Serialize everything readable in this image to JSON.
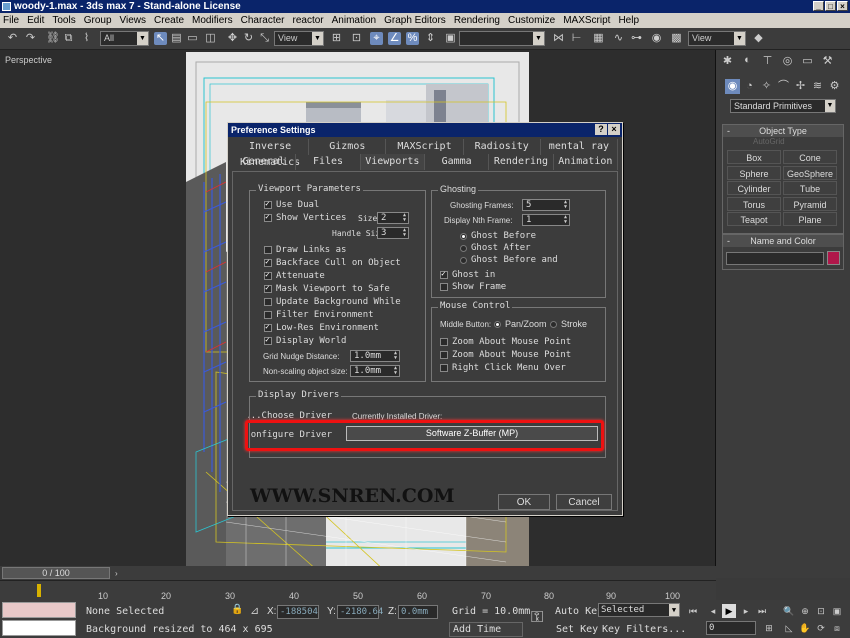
{
  "window": {
    "title": "woody-1.max - 3ds max 7 - Stand-alone License"
  },
  "menu": [
    "File",
    "Edit",
    "Tools",
    "Group",
    "Views",
    "Create",
    "Modifiers",
    "Character",
    "reactor",
    "Animation",
    "Graph Editors",
    "Rendering",
    "Customize",
    "MAXScript",
    "Help"
  ],
  "toolbar": {
    "selection_filter": "All",
    "ref_coord": "View",
    "named_sel": "",
    "view2": "View"
  },
  "viewport": {
    "label": "Perspective"
  },
  "cmdpanel": {
    "category": "Standard Primitives",
    "object_type_title": "Object Type",
    "autogrid": "AutoGrid",
    "objects": [
      "Box",
      "Cone",
      "Sphere",
      "GeoSphere",
      "Cylinder",
      "Tube",
      "Torus",
      "Pyramid",
      "Teapot",
      "Plane"
    ],
    "name_color_title": "Name and Color",
    "color": "#b0174a"
  },
  "dialog": {
    "title": "Preference Settings",
    "tabs_row1": [
      "Inverse Kinematics",
      "Gizmos",
      "MAXScript",
      "Radiosity",
      "mental ray"
    ],
    "tabs_row2": [
      "General",
      "Files",
      "Viewports",
      "Gamma",
      "Rendering",
      "Animation"
    ],
    "viewport_params": {
      "title": "Viewport Parameters",
      "use_dual": "Use Dual",
      "show_vertices": "Show Vertices",
      "size_label": "Size:",
      "size_value": "2",
      "handle_size_label": "Handle Size:",
      "handle_size_value": "3",
      "draw_links": "Draw Links as",
      "backface_cull": "Backface Cull on Object",
      "attenuate": "Attenuate",
      "mask_viewport": "Mask Viewport to Safe",
      "update_bg": "Update Background While",
      "filter_env": "Filter Environment",
      "lowres_env": "Low-Res Environment",
      "display_world": "Display World",
      "grid_nudge_label": "Grid Nudge Distance:",
      "grid_nudge_value": "1.0mm",
      "nonscaling_label": "Non-scaling object size:",
      "nonscaling_value": "1.0mm"
    },
    "ghosting": {
      "title": "Ghosting",
      "frames_label": "Ghosting Frames:",
      "frames_value": "5",
      "nth_label": "Display Nth Frame:",
      "nth_value": "1",
      "before": "Ghost Before",
      "after": "Ghost After",
      "before_and": "Ghost Before and",
      "ghost_in": "Ghost in",
      "show_frame": "Show Frame"
    },
    "mouse": {
      "title": "Mouse Control",
      "middle_label": "Middle Button:",
      "pan_zoom": "Pan/Zoom",
      "stroke": "Stroke",
      "zoom_mouse1": "Zoom About Mouse Point",
      "zoom_mouse2": "Zoom About Mouse Point",
      "right_click": "Right Click Menu Over"
    },
    "drivers": {
      "title": "Display Drivers",
      "choose": "Choose Driver...",
      "current_label": "Currently Installed Driver:",
      "configure": "Configure Driver...",
      "current_value": "Software Z-Buffer (MP)"
    },
    "ok": "OK",
    "cancel": "Cancel"
  },
  "watermark": "WWW.SNREN.COM",
  "timeline": {
    "slider": "0 / 100",
    "ticks": [
      "10",
      "20",
      "30",
      "40",
      "50",
      "60",
      "70",
      "80",
      "90",
      "100"
    ]
  },
  "status": {
    "selection": "None Selected",
    "prompt": "Background resized to 464 x 695",
    "x_label": "X:",
    "x_value": "-188504",
    "y_label": "Y:",
    "y_value": "-2180.64",
    "z_label": "Z:",
    "z_value": "0.0mm",
    "grid": "Grid = 10.0mm",
    "add_time_tag": "Add Time Tag",
    "auto_key": "Auto Key",
    "selected": "Selected",
    "set_key": "Set Key",
    "key_filters": "Key Filters...",
    "frame": "0"
  }
}
